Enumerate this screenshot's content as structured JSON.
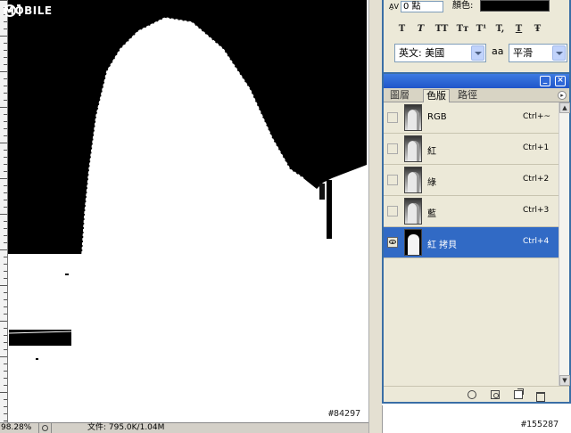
{
  "watermark": {
    "text": "MOBILE",
    "logo": "01-logo"
  },
  "canvas": {
    "image_id_text": "#84297"
  },
  "statusbar": {
    "zoom": "98.28%",
    "doc_size": "文件: 795.0K/1.04M"
  },
  "character_panel": {
    "tracking_value": "0 點",
    "color_label": "顏色:",
    "color_value": "#000000",
    "style_buttons": [
      "T",
      "T",
      "TT",
      "Tт",
      "T¹",
      "T,",
      "T",
      "Ŧ"
    ],
    "language": "英文: 美國",
    "antialias_icon": "aa",
    "antialias": "平滑"
  },
  "channels_panel": {
    "tabs": [
      "圖層",
      "色版",
      "路徑"
    ],
    "active_tab": "色版",
    "channels": [
      {
        "name": "RGB",
        "shortcut": "Ctrl+~",
        "visible": false,
        "selected": false
      },
      {
        "name": "紅",
        "shortcut": "Ctrl+1",
        "visible": false,
        "selected": false
      },
      {
        "name": "綠",
        "shortcut": "Ctrl+2",
        "visible": false,
        "selected": false
      },
      {
        "name": "藍",
        "shortcut": "Ctrl+3",
        "visible": false,
        "selected": false
      },
      {
        "name": "紅 拷貝",
        "shortcut": "Ctrl+4",
        "visible": true,
        "selected": true
      }
    ],
    "selection_color": "#316ac5"
  },
  "panel_id_text": "#155287",
  "accent_color": "#3a6ea5"
}
